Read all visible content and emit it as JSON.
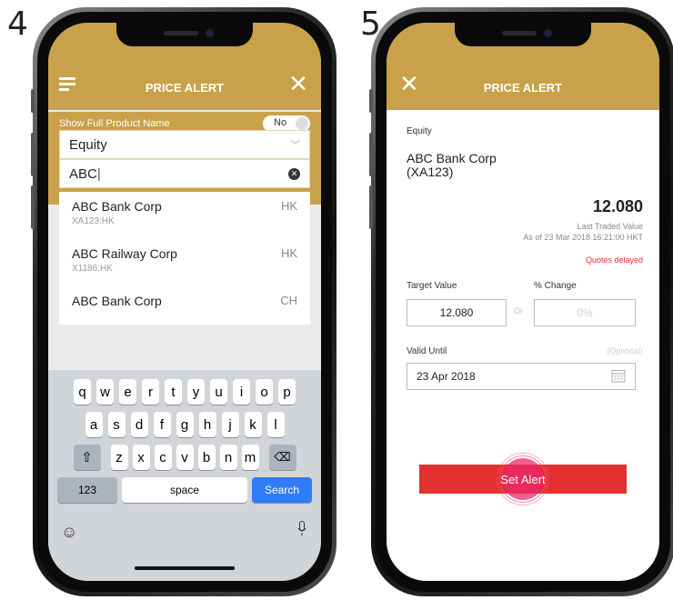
{
  "steps": [
    "4",
    "5"
  ],
  "phone4": {
    "title": "PRICE ALERT",
    "toggle_label": "Show Full Product Name",
    "toggle_value": "No",
    "category": "Equity",
    "search_value": "ABC",
    "results": [
      {
        "name": "ABC Bank Corp",
        "code": "XA123:HK",
        "market": "HK"
      },
      {
        "name": "ABC Railway Corp",
        "code": "X1186:HK",
        "market": "HK"
      },
      {
        "name": "ABC Bank Corp",
        "code": "",
        "market": "CH"
      }
    ],
    "keyboard": {
      "row1": [
        "q",
        "w",
        "e",
        "r",
        "t",
        "y",
        "u",
        "i",
        "o",
        "p"
      ],
      "row2": [
        "a",
        "s",
        "d",
        "f",
        "g",
        "h",
        "j",
        "k",
        "l"
      ],
      "row3": [
        "z",
        "x",
        "c",
        "v",
        "b",
        "n",
        "m"
      ],
      "numbers_key": "123",
      "space_key": "space",
      "search_key": "Search"
    }
  },
  "phone5": {
    "title": "PRICE ALERT",
    "category": "Equity",
    "product_name": "ABC Bank Corp",
    "product_code": "(XA123)",
    "price": "12.080",
    "price_label": "Last Traded Value",
    "as_of": "As of 23 Mar 2018 16:21:00 HKT",
    "delayed": "Quotes delayed",
    "target_label": "Target Value",
    "change_label": "% Change",
    "target_value": "12.080",
    "or_text": "Or",
    "change_placeholder": "0%",
    "valid_label": "Valid Until",
    "optional_text": "(Optional)",
    "valid_value": "23 Apr 2018",
    "button": "Set Alert"
  },
  "colors": {
    "gold": "#c9a14a",
    "red": "#e33030",
    "blue": "#2f7cf6"
  }
}
